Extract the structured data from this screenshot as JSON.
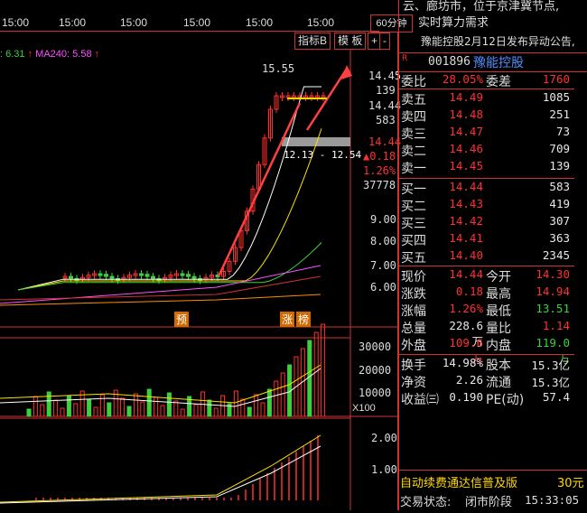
{
  "news": {
    "line1": "云、廊坊市，位于京津冀节点,",
    "line2": "实时算力需求",
    "line3": "豫能控股2月12日发布异动公告,"
  },
  "time_axis": {
    "labels": [
      "15:00",
      "15:00",
      "15:00",
      "15:00",
      "15:00",
      "15:00",
      "15:00"
    ]
  },
  "period_button": "60分钟",
  "toolbar": {
    "indicator": "指标B",
    "template": "模 板",
    "plus": "+",
    "minus": "-",
    "zoom": "?"
  },
  "ma_legend": {
    "ma_a": "6.31",
    "ma240_label": "MA240:",
    "ma240": "5.58"
  },
  "main_chart": {
    "peak_label": "15.55",
    "range_label": "12.13 - 12.54",
    "right_labels": {
      "p1": "14.45",
      "v1": "139",
      "p2": "14.44",
      "v2": "583",
      "last": "14.44",
      "chg": "▲0.18",
      "pct": "1.26%",
      "vol": "37778",
      "ticks": [
        "9.00",
        "8.00",
        "7.00",
        "6.00"
      ]
    },
    "annotation_yu": "预",
    "annotation_zhang": "涨",
    "annotation_bang": "榜"
  },
  "volume_chart": {
    "ticks": [
      "30000",
      "20000",
      "10000"
    ],
    "unit": "X100"
  },
  "macd_chart": {
    "ticks": [
      "2.00",
      "1.00"
    ]
  },
  "stock": {
    "marker": "R",
    "code": "001896",
    "name": "豫能控股"
  },
  "quote": {
    "wei_bi_label": "委比",
    "wei_bi": "28.05%",
    "wei_cha_label": "委差",
    "wei_cha": "1760",
    "asks": [
      {
        "label": "卖五",
        "price": "14.49",
        "vol": "1085"
      },
      {
        "label": "卖四",
        "price": "14.48",
        "vol": "251"
      },
      {
        "label": "卖三",
        "price": "14.47",
        "vol": "73"
      },
      {
        "label": "卖二",
        "price": "14.46",
        "vol": "709"
      },
      {
        "label": "卖一",
        "price": "14.45",
        "vol": "139"
      }
    ],
    "bids": [
      {
        "label": "买一",
        "price": "14.44",
        "vol": "583"
      },
      {
        "label": "买二",
        "price": "14.43",
        "vol": "419"
      },
      {
        "label": "买三",
        "price": "14.42",
        "vol": "307"
      },
      {
        "label": "买四",
        "price": "14.41",
        "vol": "363"
      },
      {
        "label": "买五",
        "price": "14.40",
        "vol": "2345"
      }
    ],
    "stats": [
      {
        "l1": "现价",
        "v1": "14.44",
        "l2": "今开",
        "v2": "14.30"
      },
      {
        "l1": "涨跌",
        "v1": "0.18",
        "l2": "最高",
        "v2": "14.94"
      },
      {
        "l1": "涨幅",
        "v1": "1.26%",
        "l2": "最低",
        "v2": "13.51"
      },
      {
        "l1": "总量",
        "v1": "228.6万",
        "l2": "量比",
        "v2": "1.14"
      },
      {
        "l1": "外盘",
        "v1": "109.6万",
        "l2": "内盘",
        "v2": "119.0万"
      },
      {
        "l1": "换手",
        "v1": "14.98%",
        "l2": "股本",
        "v2": "15.3亿"
      },
      {
        "l1": "净资",
        "v1": "2.26",
        "l2": "流通",
        "v2": "15.3亿"
      },
      {
        "l1": "收益㈢",
        "v1": "0.190",
        "l2": "PE(动)",
        "v2": "57.4"
      }
    ]
  },
  "status": {
    "promo": "自动续费通达信普及版",
    "promo_tag": "30元",
    "state_label": "交易状态:",
    "state": "闭市阶段",
    "time": "15:33:05"
  },
  "colors": {
    "up": "#ff3030",
    "down": "#3cd13c",
    "border": "#cc3333",
    "ma_yellow": "#ffe000",
    "ma_white": "#ffffff"
  }
}
